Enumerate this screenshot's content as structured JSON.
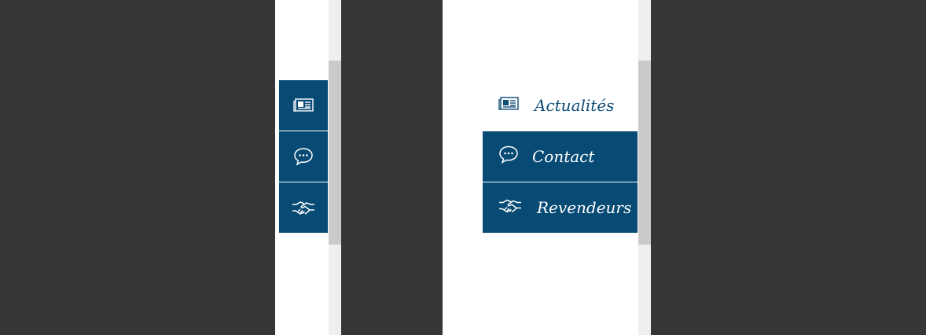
{
  "colors": {
    "background": "#373634",
    "panel": "#ffffff",
    "accent": "#074a74",
    "scrollbar_track": "#efefef",
    "scrollbar_thumb": "#cacaca"
  },
  "collapsed_menu": {
    "items": [
      {
        "icon": "newspaper-icon"
      },
      {
        "icon": "speech-bubble-icon"
      },
      {
        "icon": "handshake-icon"
      }
    ]
  },
  "expanded_menu": {
    "items": [
      {
        "label": "Actualités",
        "icon": "newspaper-icon"
      },
      {
        "label": "Contact",
        "icon": "speech-bubble-icon"
      },
      {
        "label": "Revendeurs",
        "icon": "handshake-icon"
      }
    ]
  }
}
